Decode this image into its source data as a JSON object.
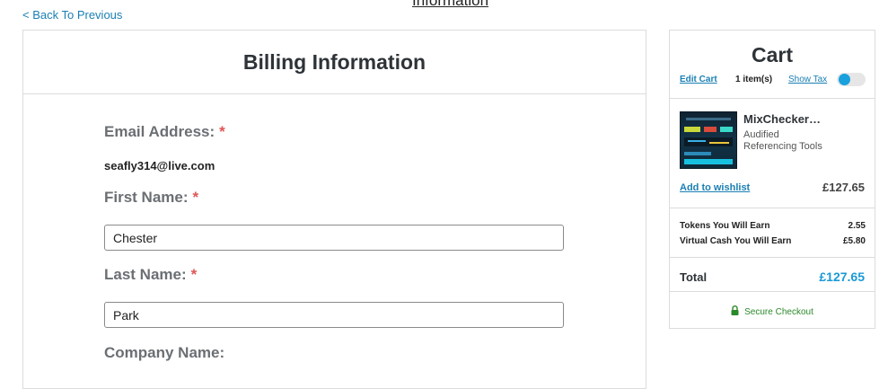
{
  "nav": {
    "back_label": "< Back To Previous",
    "top_heading_fragment": "Information"
  },
  "billing": {
    "title": "Billing Information",
    "email_label": "Email Address:",
    "email_value": "seafly314@live.com",
    "first_name_label": "First Name:",
    "first_name_value": "Chester",
    "last_name_label": "Last Name:",
    "last_name_value": "Park",
    "company_label": "Company Name:",
    "required_marker": "*"
  },
  "cart": {
    "title": "Cart",
    "edit_label": "Edit Cart",
    "items_count": "1 item(s)",
    "show_tax_label": "Show Tax",
    "show_tax_on": true,
    "product": {
      "name": "MixChecker…",
      "brand": "Audified",
      "category": "Referencing Tools",
      "wishlist_label": "Add to wishlist",
      "price": "£127.65",
      "thumbnail_icon": "plugin-screenshot-thumbnail"
    },
    "earn": [
      {
        "label": "Tokens You Will Earn",
        "value": "2.55"
      },
      {
        "label": "Virtual Cash You Will Earn",
        "value": "£5.80"
      }
    ],
    "total_label": "Total",
    "total_value": "£127.65",
    "secure_label": "Secure Checkout",
    "secure_icon": "lock-icon"
  },
  "colors": {
    "link": "#1a7fb3",
    "accent": "#1a9ad6",
    "required": "#e05555",
    "secure": "#2a8a2a"
  }
}
